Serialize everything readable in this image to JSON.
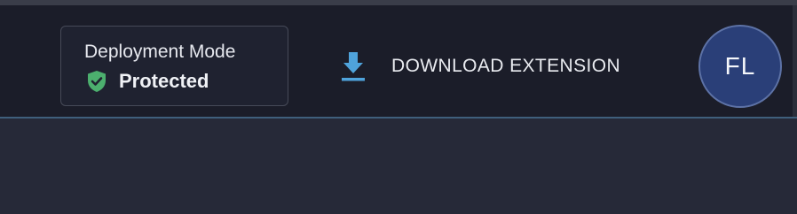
{
  "header": {
    "deployment_mode": {
      "title": "Deployment Mode",
      "status": "Protected",
      "status_icon": "shield-check-icon",
      "status_color": "#4caf6e"
    },
    "download_button": {
      "label": "DOWNLOAD EXTENSION",
      "icon": "download-icon",
      "icon_color": "#4fa3db"
    },
    "avatar": {
      "initials": "FL",
      "background": "#2a3f78"
    }
  },
  "theme": {
    "header_background": "#1b1d29",
    "page_background": "#262938",
    "divider_color": "#3f5f7c"
  }
}
